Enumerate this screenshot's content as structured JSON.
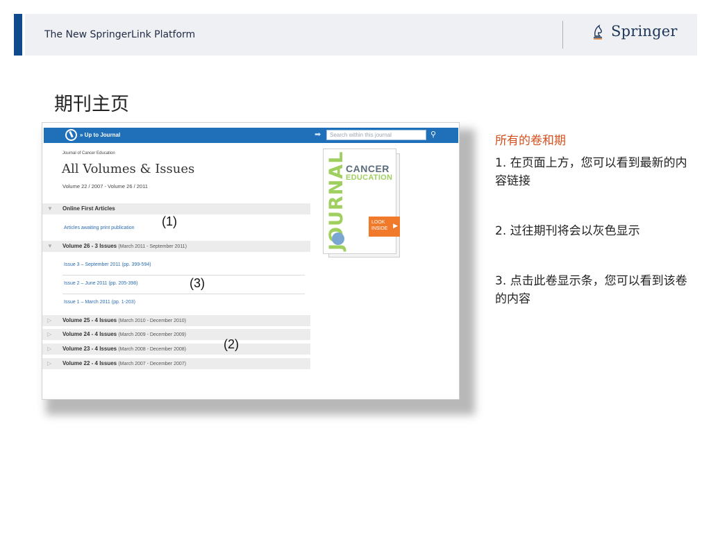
{
  "header": {
    "title": "The New SpringerLink Platform",
    "logo_text": "Springer"
  },
  "slide": {
    "title": "期刊主页"
  },
  "screenshot": {
    "topbar": {
      "up_link": "» Up to Journal",
      "search_placeholder": "Search within this journal"
    },
    "journal_name": "Journal of Cancer Education",
    "heading": "All Volumes & Issues",
    "volume_range": "Volume 22 / 2007 - Volume 26 / 2011",
    "online_first": {
      "label": "Online First Articles",
      "link": "Articles awaiting print publication"
    },
    "volume_26": {
      "label": "Volume 26 - 3 Issues",
      "dates": "(March 2011 - September 2011)",
      "issues": [
        "Issue 3 – September 2011 (pp. 399-594)",
        "Issue 2 – June 2011 (pp. 205-398)",
        "Issue 1 – March 2011 (pp. 1-203)"
      ]
    },
    "older_volumes": [
      {
        "label": "Volume 25 - 4 Issues",
        "dates": "(March 2010 - December 2010)"
      },
      {
        "label": "Volume 24 - 4 Issues",
        "dates": "(March 2009 - December 2009)"
      },
      {
        "label": "Volume 23 - 4 Issues",
        "dates": "(March 2008 - December 2008)"
      },
      {
        "label": "Volume 22 - 4 Issues",
        "dates": "(March 2007 - December 2007)"
      }
    ],
    "annotations": [
      "(1)",
      "(2)",
      "(3)"
    ],
    "cover": {
      "vertical_text": "JOURNAL",
      "title_1": "CANCER",
      "title_2": "EDUCATION",
      "look_inside": "LOOK INSIDE"
    }
  },
  "notes": {
    "heading": "所有的卷和期",
    "item_1": "1. 在页面上方，您可以看到最新的内容链接",
    "item_2": "2. 过往期刊将会以灰色显示",
    "item_3": "3. 点击此卷显示条，您可以看到该卷的内容"
  },
  "colors": {
    "accent_bar": "#0f4a8c",
    "topbar_blue": "#1f6fb9",
    "notes_heading": "#d2501d",
    "look_inside": "#f07a2a"
  }
}
